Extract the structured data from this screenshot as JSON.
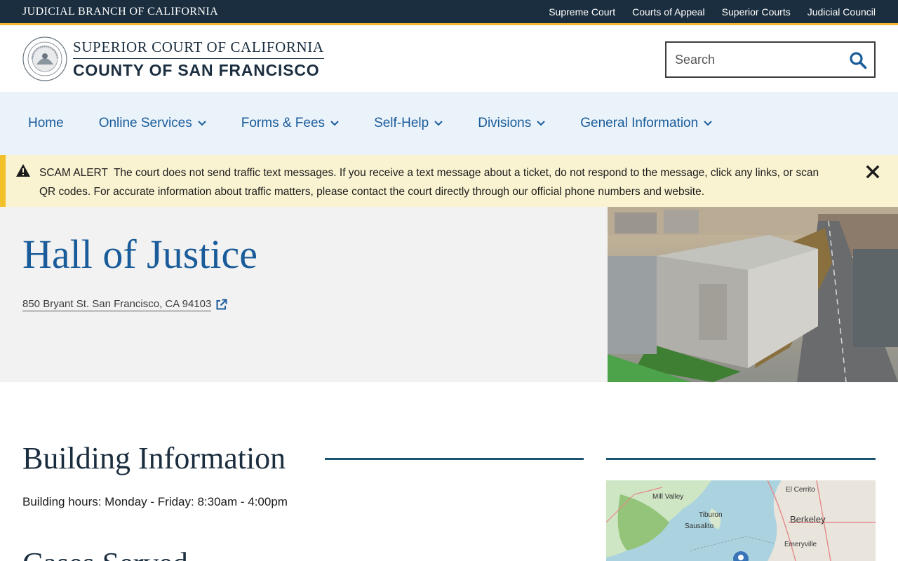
{
  "utility": {
    "title": "JUDICIAL BRANCH OF CALIFORNIA",
    "links": [
      "Supreme Court",
      "Courts of Appeal",
      "Superior Courts",
      "Judicial Council"
    ]
  },
  "header": {
    "court_line1": "SUPERIOR COURT OF CALIFORNIA",
    "court_line2": "COUNTY OF SAN FRANCISCO",
    "search_placeholder": "Search"
  },
  "nav": {
    "items": [
      "Home",
      "Online Services",
      "Forms & Fees",
      "Self-Help",
      "Divisions",
      "General Information"
    ]
  },
  "alert": {
    "title": "SCAM ALERT",
    "message": "The court does not send traffic text messages.  If you receive a text message about a ticket, do not respond to the message, click any links, or scan QR codes.  For accurate information about traffic matters, please contact the court directly through our official phone numbers and website."
  },
  "hero": {
    "title": "Hall of Justice",
    "address": "850 Bryant St. San Francisco, CA 94103"
  },
  "main": {
    "section_title": "Building Information",
    "building_hours": "Building hours: Monday - Friday: 8:30am - 4:00pm",
    "cases_title": "Cases Served"
  },
  "map": {
    "labels": [
      "Mill Valley",
      "Tiburon",
      "Sausalito",
      "Berkeley",
      "El Cerrito",
      "Emeryville"
    ]
  },
  "colors": {
    "utility_bg": "#1b2e3f",
    "accent_gold": "#f2b632",
    "link_blue": "#1a5c9a",
    "nav_bg": "#eaf2fa",
    "alert_bg": "#faf3d1"
  },
  "icons": {
    "search": "search-icon",
    "chevron": "chevron-down-icon",
    "alert": "warning-icon",
    "close": "close-icon",
    "external": "external-link-icon"
  }
}
